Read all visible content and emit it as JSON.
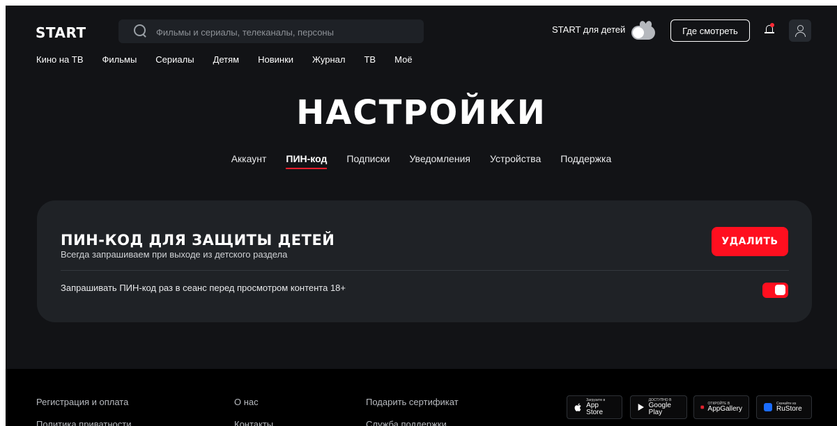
{
  "header": {
    "logo": "START",
    "search_placeholder": "Фильмы и сериалы, телеканалы, персоны",
    "kids_label": "START для детей",
    "where_to_watch": "Где смотреть"
  },
  "nav": [
    "Кино на ТВ",
    "Фильмы",
    "Сериалы",
    "Детям",
    "Новинки",
    "Журнал",
    "ТВ",
    "Моё"
  ],
  "page": {
    "title": "НАСТРОЙКИ",
    "tabs": [
      "Аккаунт",
      "ПИН-код",
      "Подписки",
      "Уведомления",
      "Устройства",
      "Поддержка"
    ],
    "active_tab": "ПИН-код"
  },
  "pin_card": {
    "title": "ПИН-КОД ДЛЯ ЗАЩИТЫ ДЕТЕЙ",
    "subtitle": "Всегда запрашиваем при выходе из детского раздела",
    "delete_label": "УДАЛИТЬ",
    "session_label": "Запрашивать ПИН-код раз в сеанс перед просмотром контента 18+",
    "session_enabled": true
  },
  "footer": {
    "col1": [
      "Регистрация и оплата",
      "Политика приватности"
    ],
    "col2": [
      "О нас",
      "Контакты"
    ],
    "col3": [
      "Подарить сертификат",
      "Служба поддержки"
    ],
    "stores": [
      {
        "small": "Загрузите в",
        "big": "App Store"
      },
      {
        "small": "ДОСТУПНО В",
        "big": "Google Play"
      },
      {
        "small": "ОТКРОЙТЕ В",
        "big": "AppGallery"
      },
      {
        "small": "Скачайте из",
        "big": "RuStore"
      }
    ]
  },
  "colors": {
    "accent": "#ff0f1f",
    "background": "#121316",
    "card": "#1f2226"
  }
}
